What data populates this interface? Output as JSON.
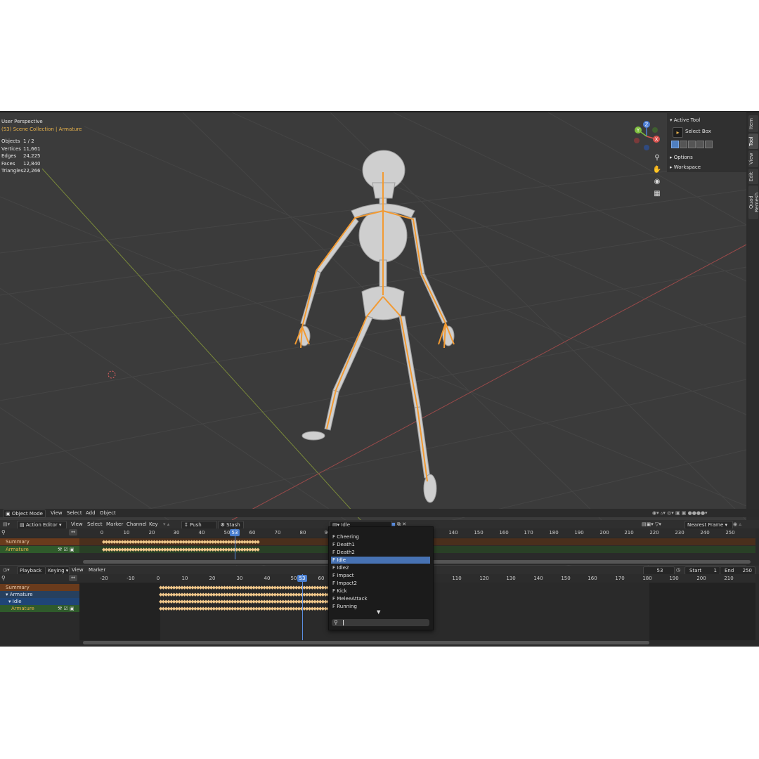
{
  "viewport": {
    "title": "User Perspective",
    "context": "(53) Scene Collection | Armature",
    "stats": [
      {
        "label": "Objects",
        "value": "1 / 2"
      },
      {
        "label": "Vertices",
        "value": "11,661"
      },
      {
        "label": "Edges",
        "value": "24,225"
      },
      {
        "label": "Faces",
        "value": "12,840"
      },
      {
        "label": "Triangles",
        "value": "22,266"
      }
    ],
    "gizmo": {
      "x": "X",
      "y": "Y",
      "z": "Z"
    },
    "header": {
      "mode": "Object Mode",
      "menus": [
        "View",
        "Select",
        "Add",
        "Object"
      ]
    }
  },
  "npanel": {
    "active_tool": "Active Tool",
    "tool_name": "Select Box",
    "options": "Options",
    "workspace": "Workspace",
    "tabs": [
      "Item",
      "Tool",
      "View",
      "Edit",
      "Quad Remesh"
    ]
  },
  "action_editor": {
    "mode": "Action Editor",
    "menus": [
      "View",
      "Select",
      "Marker",
      "Channel",
      "Key"
    ],
    "push_down": "Push Down",
    "stash": "Stash",
    "action_name": "Idle",
    "snap": "Nearest Frame",
    "ruler": [
      "0",
      "10",
      "20",
      "30",
      "40",
      "50",
      "60",
      "70",
      "80",
      "90",
      "140",
      "150",
      "160",
      "170",
      "180",
      "190",
      "200",
      "210",
      "220",
      "230",
      "240",
      "250"
    ],
    "current_frame": "53",
    "channels": [
      "Summary",
      "Armature"
    ]
  },
  "timeline": {
    "menus": [
      "Playback",
      "Keying",
      "View",
      "Marker"
    ],
    "current_frame": "53",
    "start_label": "Start",
    "start_value": "1",
    "end_label": "End",
    "end_value": "250",
    "ruler": [
      "-20",
      "-10",
      "0",
      "10",
      "20",
      "30",
      "40",
      "50",
      "60",
      "110",
      "120",
      "130",
      "140",
      "150",
      "160",
      "170",
      "180",
      "190",
      "200",
      "210"
    ],
    "channels": [
      "Summary",
      "Armature",
      "Idle",
      "Armature"
    ]
  },
  "action_dropdown": {
    "items": [
      "F Cheering",
      "F Death1",
      "F Death2",
      "F Idle",
      "F Idle2",
      "F Impact",
      "F Impact2",
      "F Kick",
      "F MeleeAttack",
      "F Running"
    ],
    "selected_index": 3
  },
  "colors": {
    "accent": "#e9b34c",
    "selection": "#4772b3",
    "summary_row": "#6a3b1c",
    "armature_row": "#2f5a2b"
  }
}
